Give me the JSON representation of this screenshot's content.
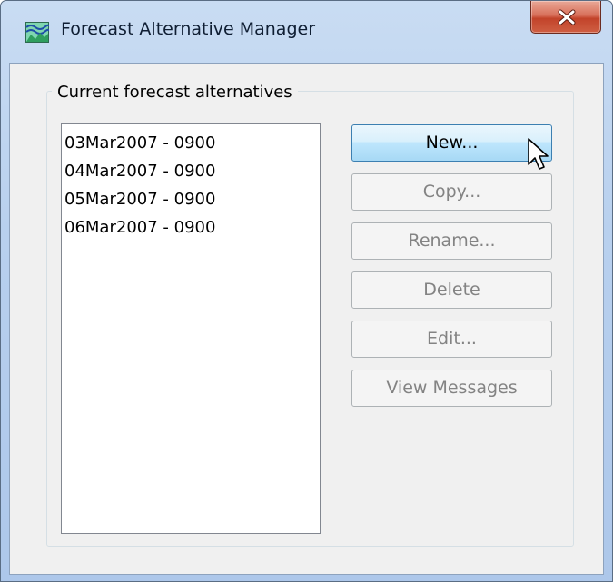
{
  "window": {
    "title": "Forecast Alternative Manager",
    "icon": "forecast-app-icon"
  },
  "group": {
    "label": "Current forecast alternatives"
  },
  "alternatives": [
    "03Mar2007 - 0900",
    "04Mar2007 - 0900",
    "05Mar2007 - 0900",
    "06Mar2007 - 0900"
  ],
  "buttons": {
    "new": "New...",
    "copy": "Copy...",
    "rename": "Rename...",
    "delete": "Delete",
    "edit": "Edit...",
    "view_messages": "View Messages"
  },
  "colors": {
    "titlebar": "#b8d0ee",
    "close_button": "#c2432a",
    "active_button": "#bee6fd",
    "disabled_text": "#838383"
  }
}
